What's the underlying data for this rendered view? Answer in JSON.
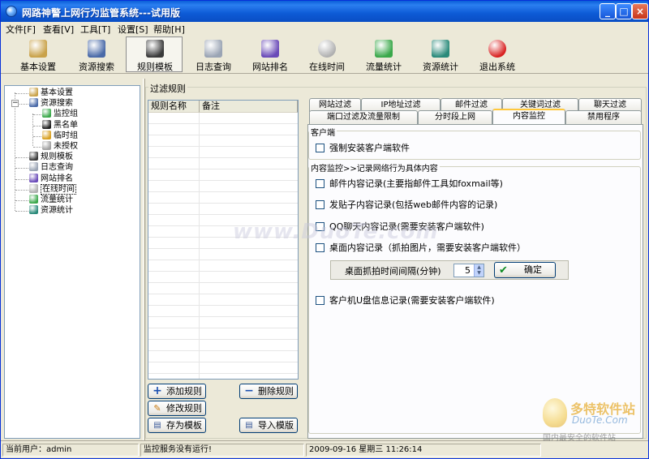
{
  "window": {
    "title": "网路神警上网行为监管系统---试用版",
    "min_label": "_",
    "max_label": "□",
    "close_label": "×"
  },
  "menu": [
    "文件[F]",
    "查看[V]",
    "工具[T]",
    "设置[S]",
    "帮助[H]"
  ],
  "toolbar": [
    {
      "label": "基本设置",
      "icon": "tools-icon",
      "color": "#c9a24a"
    },
    {
      "label": "资源搜索",
      "icon": "monitor-icon",
      "color": "#4a6aa8"
    },
    {
      "label": "规则模板",
      "icon": "traffic-light-icon",
      "color": "#3a3a3a",
      "active": true
    },
    {
      "label": "日志查询",
      "icon": "log-icon",
      "color": "#9aa4b4"
    },
    {
      "label": "网站排名",
      "icon": "ranking-icon",
      "color": "#6a4ab8"
    },
    {
      "label": "在线时间",
      "icon": "clock-icon",
      "color": "#b0b0b0"
    },
    {
      "label": "流量统计",
      "icon": "traffic-icon",
      "color": "#3aa84a"
    },
    {
      "label": "资源统计",
      "icon": "books-icon",
      "color": "#2a8a7a"
    },
    {
      "label": "退出系统",
      "icon": "power-icon",
      "color": "#d82020"
    }
  ],
  "tree": [
    {
      "label": "基本设置",
      "icon": "tools-icon",
      "color": "#c9a24a",
      "level": 0
    },
    {
      "label": "资源搜索",
      "icon": "monitor-icon",
      "color": "#4a6aa8",
      "level": 0,
      "expanded": true
    },
    {
      "label": "监控组",
      "icon": "group-icon",
      "color": "#3aa84a",
      "level": 1
    },
    {
      "label": "黑名单",
      "icon": "blacklist-icon",
      "color": "#202020",
      "level": 1
    },
    {
      "label": "临时组",
      "icon": "temp-group-icon",
      "color": "#d8a020",
      "level": 1
    },
    {
      "label": "未授权",
      "icon": "unauthorized-icon",
      "color": "#a0a0a0",
      "level": 1
    },
    {
      "label": "规则模板",
      "icon": "traffic-light-icon",
      "color": "#3a3a3a",
      "level": 0
    },
    {
      "label": "日志查询",
      "icon": "log-icon",
      "color": "#9aa4b4",
      "level": 0
    },
    {
      "label": "网站排名",
      "icon": "ranking-icon",
      "color": "#6a4ab8",
      "level": 0
    },
    {
      "label": "在线时间",
      "icon": "clock-icon",
      "color": "#b0b0b0",
      "level": 0,
      "selected": true
    },
    {
      "label": "流量统计",
      "icon": "traffic-icon",
      "color": "#3aa84a",
      "level": 0
    },
    {
      "label": "资源统计",
      "icon": "books-icon",
      "color": "#2a8a7a",
      "level": 0
    }
  ],
  "rules": {
    "group_title": "过滤规则",
    "columns": [
      "规则名称",
      "备注"
    ],
    "add_label": "添加规则",
    "delete_label": "删除规则",
    "edit_label": "修改规则",
    "save_template_label": "存为模板",
    "import_template_label": "导入模版"
  },
  "tabs_row1": [
    "网站过滤",
    "IP地址过滤",
    "邮件过滤",
    "关键词过滤",
    "聊天过滤"
  ],
  "tabs_row2": [
    "端口过滤及流量限制",
    "分时段上网",
    "内容监控",
    "禁用程序"
  ],
  "content": {
    "client_group_title": "客户端",
    "force_install_label": "强制安装客户端软件",
    "monitor_group_title": "内容监控>>记录网络行为具体内容",
    "mail_record_label": "邮件内容记录(主要指邮件工具如foxmail等)",
    "post_record_label": "发贴子内容记录(包括web邮件内容的记录)",
    "qq_record_label": "QQ聊天内容记录(需要安装客户端软件)",
    "desktop_record_label": "桌面内容记录（抓拍图片，需要安装客户端软件）",
    "interval_label": "桌面抓拍时间间隔(分钟)",
    "interval_value": "5",
    "ok_label": "确定",
    "usb_record_label": "客户机U盘信息记录(需要安装客户端软件)"
  },
  "status": {
    "user": "当前用户：admin",
    "service": "监控服务没有运行!",
    "datetime": "2009-09-16 星期三 11:26:14"
  },
  "watermarks": {
    "center": "www.DuoTe.com",
    "logo_line1": "多特软件站",
    "logo_line2": "DuoTe.Com",
    "logo_line3": "国内最安全的软件站"
  }
}
